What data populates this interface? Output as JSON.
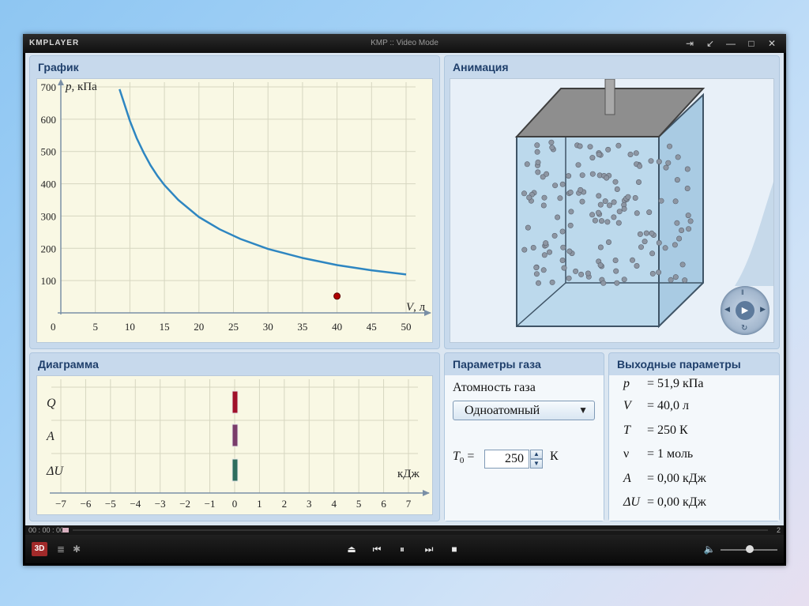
{
  "window": {
    "logo": "KMPLAYER",
    "title": "KMP :: Video Mode",
    "buttons": [
      "⇥",
      "↙",
      "—",
      "□",
      "✕"
    ]
  },
  "graph_panel": {
    "title": "График",
    "ylabel_sym": "p",
    "ylabel_unit": ", кПа",
    "xlabel_sym": "V",
    "xlabel_unit": ", л",
    "origin": "0",
    "chart_data": {
      "type": "line",
      "x_ticks": [
        5,
        10,
        15,
        20,
        25,
        30,
        35,
        40,
        45,
        50
      ],
      "y_ticks": [
        100,
        200,
        300,
        400,
        500,
        600,
        700
      ],
      "xlim": [
        0,
        50
      ],
      "ylim": [
        0,
        700
      ],
      "grid": true,
      "series": [
        {
          "x": [
            8.5,
            9,
            10,
            11,
            12,
            13,
            14,
            15,
            17,
            20,
            23,
            26,
            30,
            35,
            40,
            45,
            50
          ],
          "y": [
            693,
            660,
            595,
            541,
            496,
            457,
            424,
            396,
            350,
            297,
            259,
            229,
            198,
            170,
            148,
            132,
            119
          ]
        }
      ],
      "marker": {
        "x": 40,
        "y": 51.9
      },
      "line_color": "#2e86c1",
      "marker_color": "#b00000"
    }
  },
  "animation_panel": {
    "title": "Анимация"
  },
  "diagram_panel": {
    "title": "Диаграмма",
    "unit": "кДж",
    "rows": [
      "Q",
      "A",
      "ΔU"
    ],
    "chart_data": {
      "type": "bar",
      "orientation": "horizontal",
      "categories": [
        "Q",
        "A",
        "ΔU"
      ],
      "values": [
        0,
        0,
        0
      ],
      "x_ticks": [
        -7,
        -6,
        -5,
        -4,
        -3,
        -2,
        -1,
        0,
        1,
        2,
        3,
        4,
        5,
        6,
        7
      ],
      "x_tick_labels": [
        "−7",
        "−6",
        "−5",
        "−4",
        "−3",
        "−2",
        "−1",
        "0",
        "1",
        "2",
        "3",
        "4",
        "5",
        "6",
        "7"
      ],
      "xlim": [
        -7,
        7
      ],
      "grid": true,
      "bar_colors": [
        "#a0102a",
        "#7a3c6a",
        "#2e6e5e"
      ]
    }
  },
  "gas_params_panel": {
    "title": "Параметры газа",
    "atomicity_label": "Атомность газа",
    "atomicity_value": "Одноатомный",
    "t0_sym": "T",
    "t0_sub": "0",
    "t0_eq": "=",
    "t0_value": "250",
    "t0_unit": "К"
  },
  "output_panel": {
    "title": "Выходные параметры",
    "rows": [
      {
        "sym": "p",
        "val": "= 51,9 кПа"
      },
      {
        "sym": "V",
        "val": "= 40,0 л"
      },
      {
        "sym": "T",
        "val": "= 250 К"
      },
      {
        "sym": "ν",
        "val": "= 1 моль"
      },
      {
        "sym": "A",
        "val": "= 0,00 кДж"
      },
      {
        "sym": "ΔU",
        "val": "= 0,00 кДж"
      }
    ]
  },
  "player": {
    "time": "00 : 00 : 00",
    "end_num": "2",
    "badge": "3D",
    "controls": {
      "eject": "⏏",
      "prev": "⏮",
      "pause": "⏸",
      "next": "⏭",
      "stop": "■",
      "volume": "🔈"
    }
  }
}
